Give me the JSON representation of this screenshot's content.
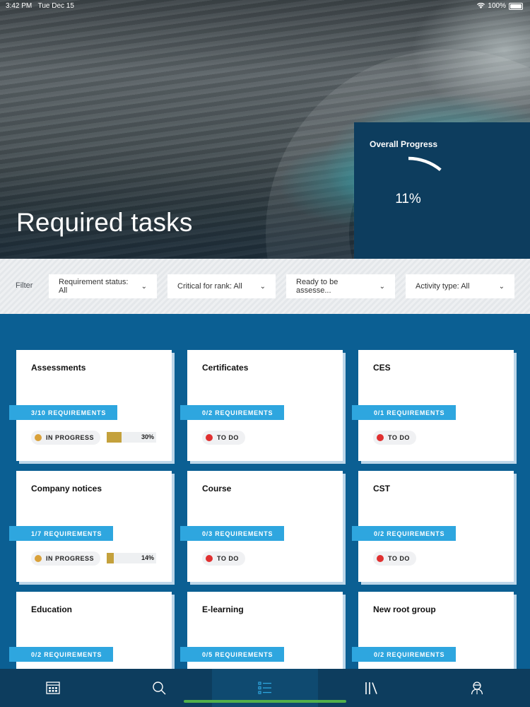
{
  "status_bar": {
    "time": "3:42 PM",
    "date": "Tue Dec 15",
    "battery": "100%"
  },
  "hero": {
    "title": "Required tasks",
    "progress": {
      "label": "Overall Progress",
      "value_text": "11%",
      "value": 11
    }
  },
  "filters": {
    "label": "Filter",
    "items": [
      {
        "text": "Requirement status: All"
      },
      {
        "text": "Critical for rank: All"
      },
      {
        "text": "Ready to be assesse..."
      },
      {
        "text": "Activity type: All"
      }
    ]
  },
  "colors": {
    "in_progress": "#d9a13a",
    "to_do": "#e03030",
    "badge": "#2ea6df",
    "progress_fill": "#c4a13c"
  },
  "cards": [
    {
      "title": "Assessments",
      "requirements": "3/10 REQUIREMENTS",
      "status": "IN PROGRESS",
      "status_kind": "in_progress",
      "progress_text": "30%",
      "progress": 30
    },
    {
      "title": "Certificates",
      "requirements": "0/2 REQUIREMENTS",
      "status": "TO DO",
      "status_kind": "to_do"
    },
    {
      "title": "CES",
      "requirements": "0/1 REQUIREMENTS",
      "status": "TO DO",
      "status_kind": "to_do"
    },
    {
      "title": "Company notices",
      "requirements": "1/7 REQUIREMENTS",
      "status": "IN PROGRESS",
      "status_kind": "in_progress",
      "progress_text": "14%",
      "progress": 14
    },
    {
      "title": "Course",
      "requirements": "0/3 REQUIREMENTS",
      "status": "TO DO",
      "status_kind": "to_do"
    },
    {
      "title": "CST",
      "requirements": "0/2 REQUIREMENTS",
      "status": "TO DO",
      "status_kind": "to_do"
    },
    {
      "title": "Education",
      "requirements": "0/2 REQUIREMENTS"
    },
    {
      "title": "E-learning",
      "requirements": "0/5 REQUIREMENTS"
    },
    {
      "title": "New root group",
      "requirements": "0/2 REQUIREMENTS"
    }
  ],
  "nav": [
    {
      "icon": "dashboard-icon"
    },
    {
      "icon": "search-icon"
    },
    {
      "icon": "list-icon",
      "active": true
    },
    {
      "icon": "library-icon"
    },
    {
      "icon": "profile-icon"
    }
  ]
}
